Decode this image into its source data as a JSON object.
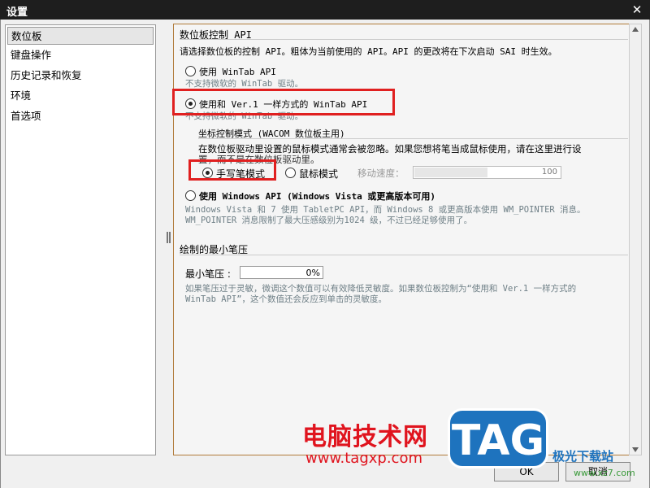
{
  "window": {
    "title": "设置",
    "close_label": "✕"
  },
  "sidebar": {
    "items": [
      {
        "label": "数位板",
        "selected": true
      },
      {
        "label": "键盘操作"
      },
      {
        "label": "历史记录和恢复"
      },
      {
        "label": "环境"
      },
      {
        "label": "首选项"
      }
    ]
  },
  "tablet": {
    "section_title": "数位板控制 API",
    "intro": "请选择数位板的控制 API。粗体为当前使用的 API。API 的更改将在下次启动 SAI 时生效。",
    "option_wintab": "使用 WinTab API",
    "wintab_note": "不支持微软的 WinTab 驱动。",
    "option_ver1": "使用和 Ver.1 一样方式的 WinTab API",
    "ver1_note": "不支持微软的 WinTab 驱动。",
    "coord_title": "坐标控制模式 (WACOM 数位板主用)",
    "coord_desc_1": "在数位板驱动里设置的鼠标模式通常会被忽略。如果您想将笔当成鼠标使用，请在这里进行设",
    "coord_desc_2": "置，而不是在数位板驱动里。",
    "mode_pen": "手写笔模式",
    "mode_mouse": "鼠标模式",
    "speed_label": "移动速度：",
    "speed_value": "100",
    "option_winapi": "使用 Windows API (Windows Vista 或更高版本可用)",
    "winapi_note_1": "Windows Vista 和 7 使用 TabletPC API，而 Windows 8 或更高版本使用 WM_POINTER 消息。",
    "winapi_note_2": "WM_POINTER 消息限制了最大压感级别为1024 级，不过已经足够使用了。"
  },
  "pressure": {
    "section_title": "绘制的最小笔压",
    "label": "最小笔压 :",
    "value": "0%",
    "note_1": "如果笔压过于灵敏，微调这个数值可以有效降低灵敏度。如果数位板控制为“使用和 Ver.1 一样方式的",
    "note_2": "WinTab API”，这个数值还会反应到单击的灵敏度。"
  },
  "buttons": {
    "ok": "OK",
    "cancel": "取消"
  },
  "watermark": {
    "cn": "电脑技术网",
    "url": "www.tagxp.com",
    "tag": "TAG",
    "jg": "极光下载站",
    "jg_url": "www.xz7.com"
  }
}
